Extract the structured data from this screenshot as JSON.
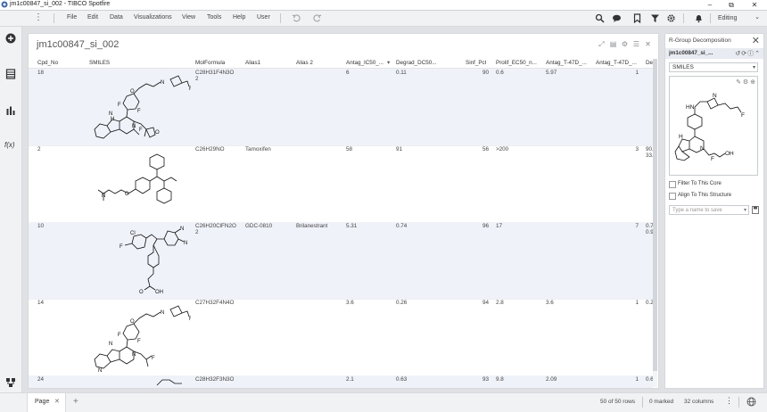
{
  "window": {
    "title": "jm1c00847_si_002 - TIBCO Spotfire",
    "minimize": "–",
    "maximize": "⧉",
    "close": "✕"
  },
  "menu": {
    "items": [
      "File",
      "Edit",
      "Data",
      "Visualizations",
      "View",
      "Tools",
      "Help",
      "User"
    ],
    "mode": "Editing",
    "mode_caret": "⌄"
  },
  "colors": {
    "accent": "#3a63b8",
    "row_alt": "#eff2f8",
    "chrome": "#f1f2f4"
  },
  "table": {
    "title": "jm1c00847_si_002",
    "columns": [
      "Cpd_No",
      "SMILES",
      "MolFormula",
      "Alias1",
      "Alias 2",
      "Antag_IC50_...",
      "Degrad_DC50...",
      "Sinf_Pct",
      "Prolif_EC50_n...",
      "Antag_T-47D_...",
      "Antag_T-47D_...",
      "De"
    ],
    "sort_indicator": "▾",
    "rows": [
      {
        "cpd": "18",
        "formula": "C28H31F4N3O",
        "formula2": "2",
        "alias1": "",
        "alias2": "",
        "antag": "6",
        "degrad": "0.11",
        "sinf": "90",
        "prolif": "0.6",
        "t47d1": "5.97",
        "t47d2": "1",
        "de": "",
        "de2": ""
      },
      {
        "cpd": "2",
        "formula": "C26H29NO",
        "formula2": "",
        "alias1": "Tamoxifen",
        "alias2": "",
        "antag": "58",
        "degrad": "91",
        "sinf": "56",
        "prolif": ">200",
        "t47d1": "",
        "t47d2": "3",
        "de": "90.",
        "de2": "33."
      },
      {
        "cpd": "10",
        "formula": "C26H20ClFN2O",
        "formula2": "2",
        "alias1": "GDC-0810",
        "alias2": "Brilanestrant",
        "antag": "5.31",
        "degrad": "0.74",
        "sinf": "96",
        "prolif": "17",
        "t47d1": "",
        "t47d2": "7",
        "de": "0.7",
        "de2": "0.9"
      },
      {
        "cpd": "14",
        "formula": "C27H32F4N4O",
        "formula2": "",
        "alias1": "",
        "alias2": "",
        "antag": "3.6",
        "degrad": "0.26",
        "sinf": "94",
        "prolif": "2.8",
        "t47d1": "3.6",
        "t47d2": "1",
        "de": "0.2",
        "de2": ""
      },
      {
        "cpd": "24",
        "formula": "C28H32F3N3O",
        "formula2": "",
        "alias1": "",
        "alias2": "",
        "antag": "2.1",
        "degrad": "0.63",
        "sinf": "93",
        "prolif": "9.8",
        "t47d1": "2.09",
        "t47d2": "1",
        "de": "0.6",
        "de2": ""
      }
    ],
    "mol_labels": {
      "F": "F",
      "N": "N",
      "NH": "N",
      "H": "H",
      "O": "O",
      "Cl": "Cl",
      "OH": "OH",
      "HN": "HN"
    }
  },
  "rgroup": {
    "title": "R-Group Decomposition",
    "tab": "jm1c00847_si_...",
    "selected_column": "SMILES",
    "filter_core": "Filter To This Core",
    "align_structure": "Align To This Structure",
    "name_placeholder": "Type a name to save",
    "mol_labels": {
      "HN": "HN",
      "N": "N",
      "F": "F",
      "OH": "OH",
      "H": "H"
    }
  },
  "status": {
    "page_tab": "Page",
    "page_close": "✕",
    "add_page": "+",
    "rows": "50 of 50 rows",
    "marked": "0 marked",
    "columns": "32 columns",
    "more": "⋮"
  }
}
